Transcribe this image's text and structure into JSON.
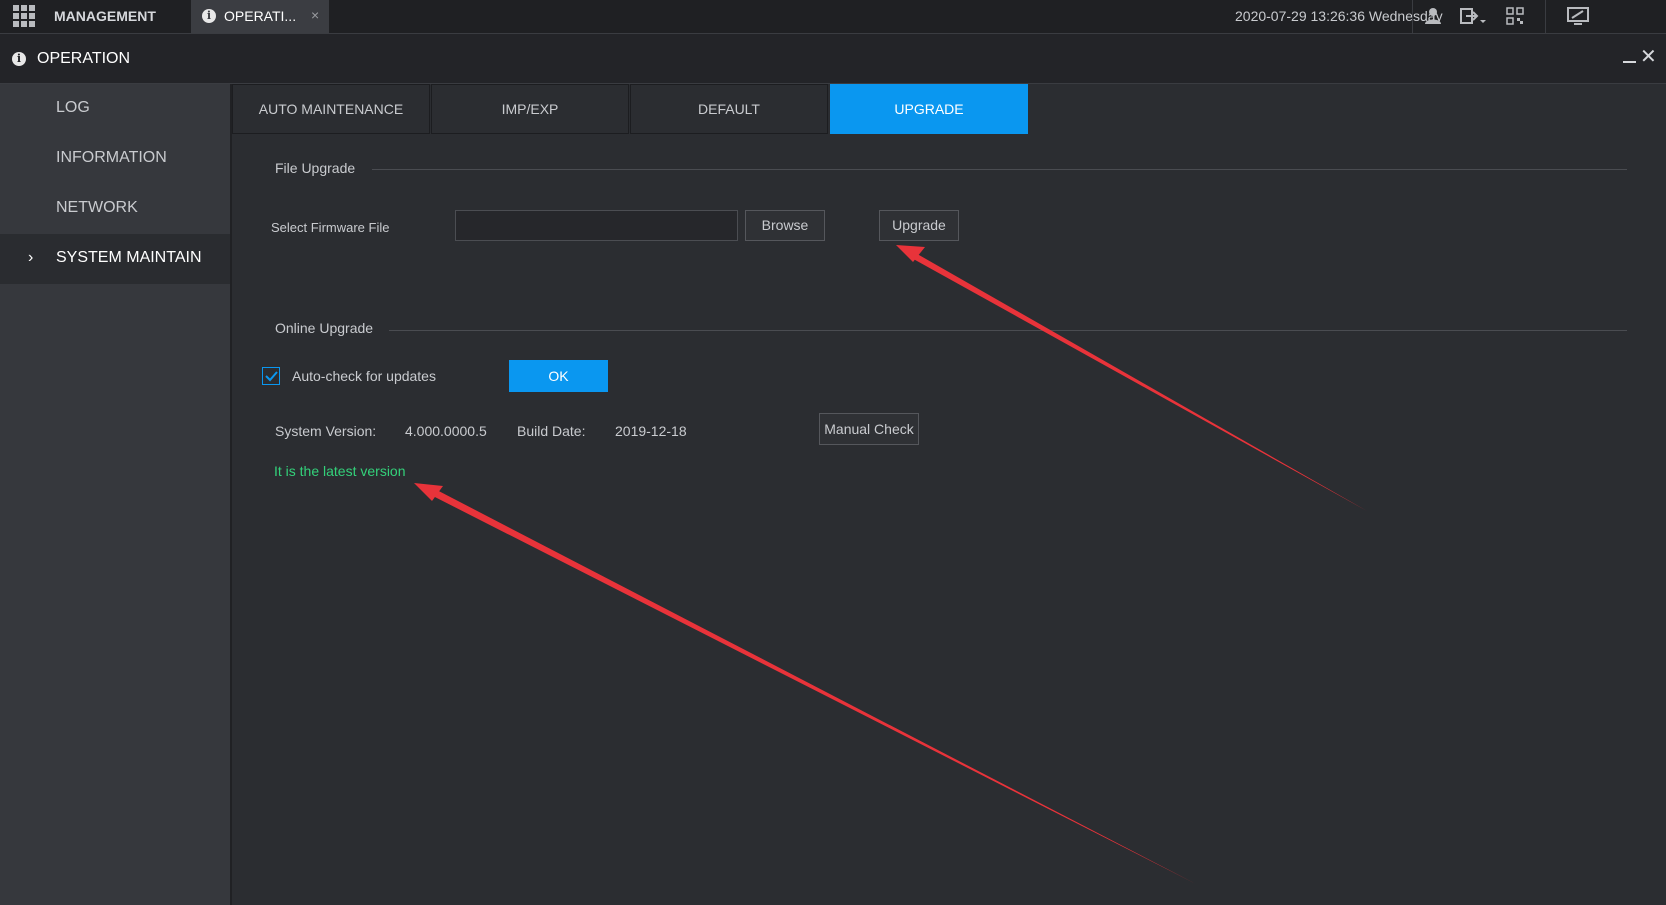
{
  "topbar": {
    "app_label": "MANAGEMENT",
    "tab_label": "OPERATI...",
    "tab_close": "×",
    "datetime": "2020-07-29 13:26:36 Wednesday",
    "icons": [
      "user-icon",
      "logout-icon",
      "qr-code-icon",
      "monitor-icon"
    ]
  },
  "window": {
    "title": "OPERATION"
  },
  "sidebar": {
    "items": [
      {
        "label": "LOG"
      },
      {
        "label": "INFORMATION"
      },
      {
        "label": "NETWORK"
      },
      {
        "label": "SYSTEM MAINTAIN",
        "active": true
      }
    ]
  },
  "tabs": [
    {
      "label": "AUTO MAINTENANCE"
    },
    {
      "label": "IMP/EXP"
    },
    {
      "label": "DEFAULT"
    },
    {
      "label": "UPGRADE",
      "active": true
    }
  ],
  "file_upgrade": {
    "section_title": "File Upgrade",
    "select_label": "Select Firmware File",
    "file_value": "",
    "browse_label": "Browse",
    "upgrade_label": "Upgrade"
  },
  "online_upgrade": {
    "section_title": "Online Upgrade",
    "autocheck_label": "Auto-check for updates",
    "autocheck_checked": true,
    "ok_label": "OK",
    "system_version_label": "System Version:",
    "system_version_value": "4.000.0000.5",
    "build_date_label": "Build Date:",
    "build_date_value": "2019-12-18",
    "manual_check_label": "Manual Check",
    "status_text": "It is the latest version"
  },
  "colors": {
    "accent": "#0a97f0",
    "status_ok": "#33d17a",
    "annotation_arrow": "#e8333a"
  }
}
